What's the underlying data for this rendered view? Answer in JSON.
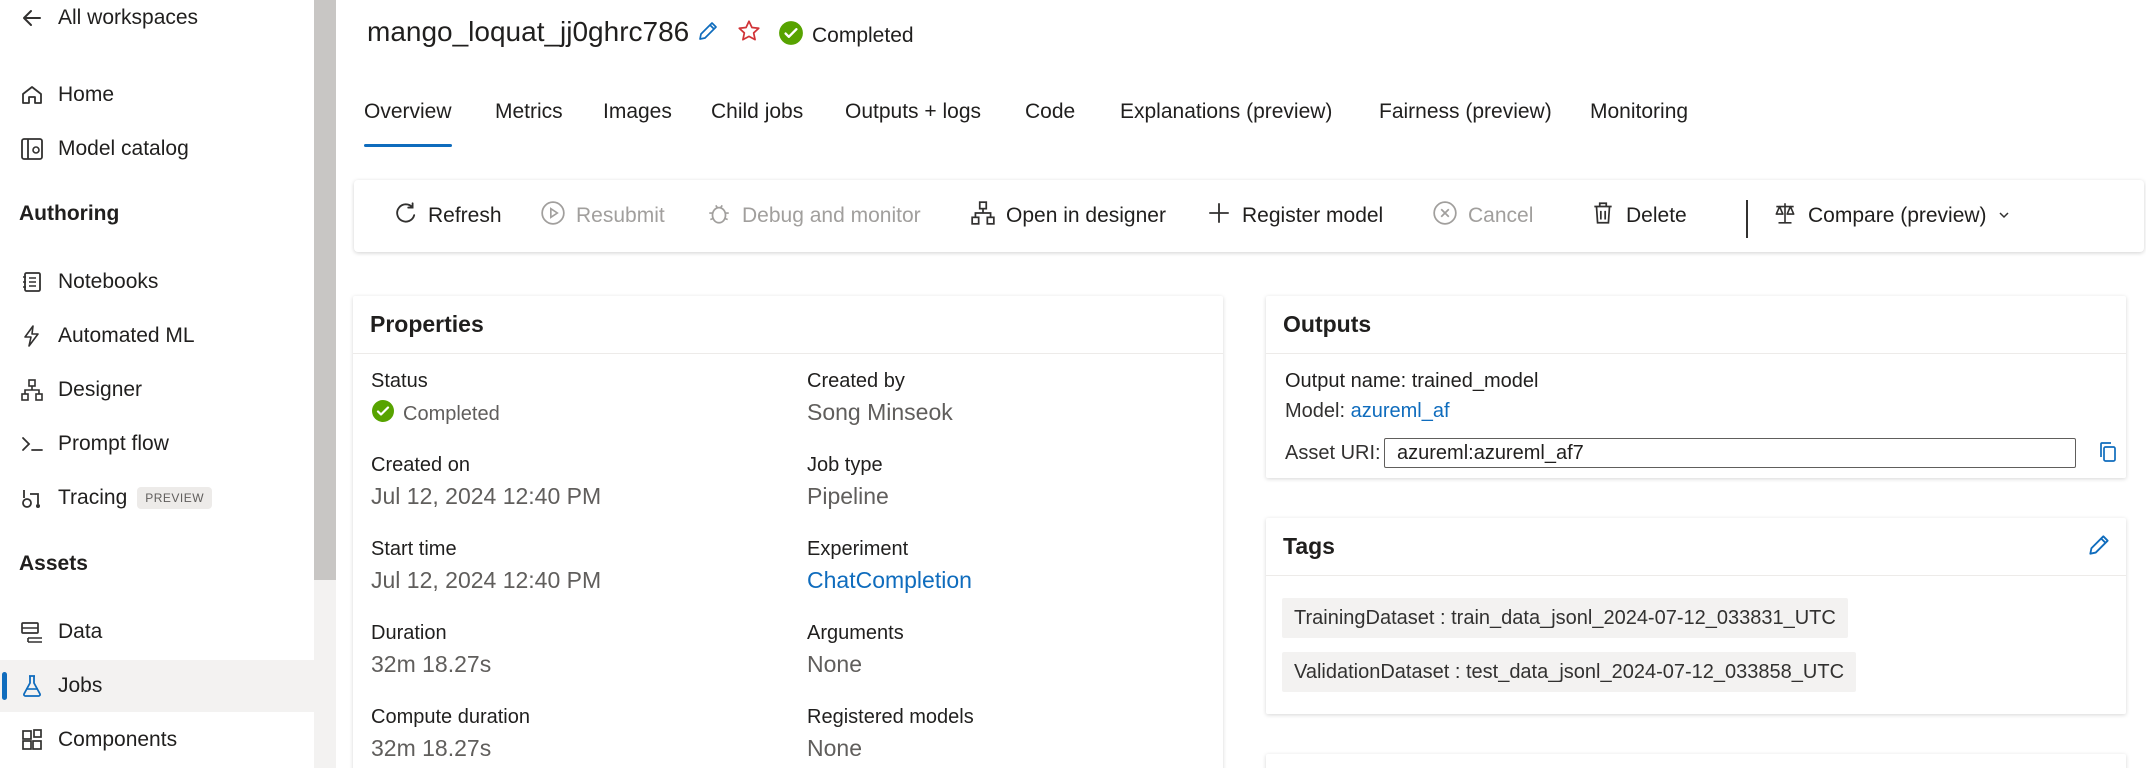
{
  "sidebar": {
    "back_label": "All workspaces",
    "items_top": [
      {
        "label": "Home",
        "icon": "home-icon"
      },
      {
        "label": "Model catalog",
        "icon": "model-catalog-icon"
      }
    ],
    "section_authoring": "Authoring",
    "items_authoring": [
      {
        "label": "Notebooks",
        "icon": "notebook-icon"
      },
      {
        "label": "Automated ML",
        "icon": "automated-ml-icon"
      },
      {
        "label": "Designer",
        "icon": "designer-icon"
      },
      {
        "label": "Prompt flow",
        "icon": "prompt-flow-icon"
      },
      {
        "label": "Tracing",
        "icon": "tracing-icon",
        "badge": "PREVIEW"
      }
    ],
    "section_assets": "Assets",
    "items_assets": [
      {
        "label": "Data",
        "icon": "data-icon"
      },
      {
        "label": "Jobs",
        "icon": "jobs-icon",
        "active": true
      },
      {
        "label": "Components",
        "icon": "components-icon"
      }
    ]
  },
  "header": {
    "title": "mango_loquat_jj0ghrc786",
    "status": "Completed"
  },
  "tabs": [
    "Overview",
    "Metrics",
    "Images",
    "Child jobs",
    "Outputs + logs",
    "Code",
    "Explanations (preview)",
    "Fairness (preview)",
    "Monitoring"
  ],
  "toolbar": {
    "refresh": "Refresh",
    "resubmit": "Resubmit",
    "debug": "Debug and monitor",
    "open_designer": "Open in designer",
    "register_model": "Register model",
    "cancel": "Cancel",
    "delete": "Delete",
    "compare": "Compare (preview)"
  },
  "properties": {
    "heading": "Properties",
    "status_label": "Status",
    "status_value": "Completed",
    "created_on_label": "Created on",
    "created_on_value": "Jul 12, 2024 12:40 PM",
    "start_time_label": "Start time",
    "start_time_value": "Jul 12, 2024 12:40 PM",
    "duration_label": "Duration",
    "duration_value": "32m 18.27s",
    "compute_duration_label": "Compute duration",
    "compute_duration_value": "32m 18.27s",
    "created_by_label": "Created by",
    "created_by_value": "Song Minseok",
    "job_type_label": "Job type",
    "job_type_value": "Pipeline",
    "experiment_label": "Experiment",
    "experiment_value": "ChatCompletion",
    "arguments_label": "Arguments",
    "arguments_value": "None",
    "registered_models_label": "Registered models",
    "registered_models_value": "None"
  },
  "outputs": {
    "heading": "Outputs",
    "output_name": "Output name: trained_model",
    "model_label": "Model:",
    "model_value": "azureml_af",
    "asset_uri_label": "Asset URI:",
    "asset_uri_value": "azureml:azureml_af7"
  },
  "tags": {
    "heading": "Tags",
    "items": [
      "TrainingDataset : train_data_jsonl_2024-07-12_033831_UTC",
      "ValidationDataset : test_data_jsonl_2024-07-12_033858_UTC"
    ]
  },
  "colors": {
    "accent": "#0f6cbd",
    "success": "#57a300",
    "star": "#d13438"
  }
}
